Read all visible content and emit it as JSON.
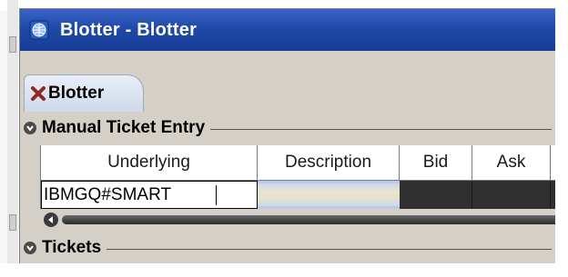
{
  "window": {
    "title": "Blotter - Blotter",
    "titlebar_color": "#1f4aa8"
  },
  "tabs": [
    {
      "label": "Blotter",
      "active": true,
      "close_icon": "close-x-icon"
    }
  ],
  "sections": {
    "manual_ticket_entry": {
      "label": "Manual Ticket Entry",
      "collapse_icon": "collapse-chevron-icon"
    },
    "tickets": {
      "label": "Tickets",
      "collapse_icon": "collapse-chevron-icon"
    }
  },
  "grid": {
    "columns": [
      "Underlying",
      "Description",
      "Bid",
      "Ask"
    ],
    "row": {
      "underlying_value": "IBMGQ#SMART",
      "description": "",
      "bid": "",
      "ask": ""
    }
  },
  "colors": {
    "accent": "#1f4aa8",
    "panel": "#d4d0c8",
    "dark_cell": "#2f2f2f",
    "tab_close": "#a0302a"
  }
}
